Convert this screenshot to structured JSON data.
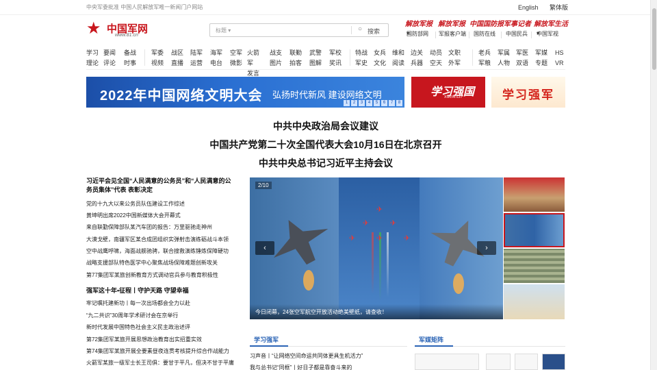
{
  "topbar": {
    "left_text": "中央军委批准 中国人民解放军唯一新闻门户网站",
    "lang_en": "English",
    "lang_tw": "繁体版"
  },
  "logo": {
    "name": "中国军网",
    "url": "www.81.cn"
  },
  "search": {
    "select_label": "标题",
    "button_label": "搜索"
  },
  "papers": {
    "mastheads": [
      "解放军报",
      "解放军报",
      "中国国防报",
      "军事记者",
      "解放军生活"
    ],
    "links": [
      "国防部网",
      "军报客户端",
      "国防在线",
      "中国民兵",
      "中国军视"
    ]
  },
  "nav": [
    [
      "学习",
      "理论"
    ],
    [
      "要闻",
      "评论"
    ],
    [
      "备战",
      "时事"
    ],
    [
      "军委",
      "视频"
    ],
    [
      "战区",
      "直播"
    ],
    [
      "陆军",
      "运营"
    ],
    [
      "海军",
      "电台"
    ],
    [
      "空军",
      "微影"
    ],
    [
      "火箭军",
      "发言人"
    ],
    [
      "战支",
      "图片"
    ],
    [
      "联勤",
      "拍客"
    ],
    [
      "武警",
      "图解"
    ],
    [
      "军校",
      "奖讯"
    ],
    [
      "特战",
      "军史"
    ],
    [
      "女兵",
      "文化"
    ],
    [
      "维和",
      "阅读"
    ],
    [
      "边关",
      "兵器"
    ],
    [
      "动员",
      "空天"
    ],
    [
      "文职",
      "外军"
    ],
    [
      "老兵",
      "军粮"
    ],
    [
      "军属",
      "人物"
    ],
    [
      "军医",
      "双语"
    ],
    [
      "军媒",
      "专题"
    ],
    [
      "HS",
      "VR"
    ]
  ],
  "banners": {
    "main_title": "2022年中国网络文明大会",
    "main_slogan": "弘扬时代新风 建设网络文明",
    "main_nums": [
      "1",
      "2",
      "3",
      "4",
      "5",
      "6",
      "7",
      "8"
    ],
    "xuexi_title": "学习强国",
    "xuexi_sub": "xuexi.cn",
    "qiangjun": "学习强军"
  },
  "headlines": [
    "中共中央政治局会议建议",
    "中国共产党第二十次全国代表大会10月16日在北京召开",
    "中共中央总书记习近平主持会议"
  ],
  "left_news": {
    "lead": "习近平会见全国“人民满意的公务员”和“人民满意的公务员集体”代表 表彰决定",
    "items": [
      "党的十九大以来公务员队伍建设工作综述",
      "黄坤明出席2022中国新媒体大会开幕式",
      "来自联勤保障部队某汽车团的报告：万里驱驰走神州",
      "大漠戈壁，南疆军区某合成团组织实弹射击演练砺战斗本领",
      "空中战鹰呼啸，海面战舰驰骋，联合搜救演练锤炼保障硬功",
      "战略支援部队特色医学中心聚焦战场保障难题创新攻关",
      "第77集团军某旅创新教育方式调动官兵参与教育积极性"
    ],
    "lead2": "强军这十年•征程丨守护天路 守望幸福",
    "items2": [
      "牢记嘱托建新功丨每一次出场都会全力以赴",
      "“九二共识”30周年学术研讨会在京举行",
      "新时代发展中国特色社会主义民主政治述评",
      "第72集团军某旅开展思想政治教育出实招重实效",
      "第74集团军某旅开展全要素昼夜连贯考核提升综合作战能力",
      "火箭军某旅一级军士长王司俱：要甘于平凡，但决不甘于平庸"
    ]
  },
  "carousel": {
    "counter": "2/10",
    "caption": "今日闭幕，24张空军航空开放活动绝美壁纸，请查收！",
    "prev": "‹",
    "next": "›"
  },
  "sections": {
    "study": "学习强军",
    "media": "军媒矩阵"
  },
  "study_items": [
    "习声音丨“让网络空间命运共同体更具生机活力”",
    "我与总书记“同框”丨好日子都是靠奋斗来的"
  ],
  "colors": {
    "brand_red": "#c8161d",
    "accent_blue": "#2a63b5"
  }
}
